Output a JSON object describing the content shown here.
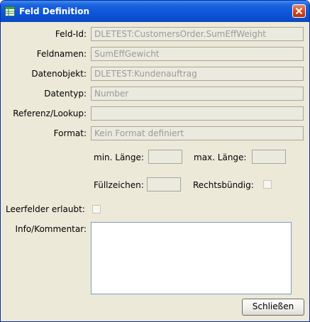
{
  "window": {
    "title": "Feld Definition",
    "close_icon": "close-icon",
    "app_icon": "table-icon"
  },
  "form": {
    "feld_id": {
      "label": "Feld-Id:",
      "value": "DLETEST:CustomersOrder.SumEffWeight"
    },
    "feldnamen": {
      "label": "Feldnamen:",
      "value": "SumEffGewicht"
    },
    "datenobjekt": {
      "label": "Datenobjekt:",
      "value": "DLETEST:Kundenauftrag"
    },
    "datentyp": {
      "label": "Datentyp:",
      "value": "Number"
    },
    "referenz": {
      "label": "Referenz/Lookup:",
      "value": ""
    },
    "format": {
      "label": "Format:",
      "value": "Kein Format definiert"
    },
    "min_laenge": {
      "label": "min. Länge:",
      "value": ""
    },
    "max_laenge": {
      "label": "max. Länge:",
      "value": ""
    },
    "fuellzeichen": {
      "label": "Füllzeichen:",
      "value": ""
    },
    "rechtsbuendig": {
      "label": "Rechtsbündig:",
      "checked": false
    },
    "leerfelder": {
      "label": "Leerfelder erlaubt:",
      "checked": false
    },
    "info": {
      "label": "Info/Kommentar:",
      "value": ""
    }
  },
  "buttons": {
    "close_label": "Schließen"
  }
}
